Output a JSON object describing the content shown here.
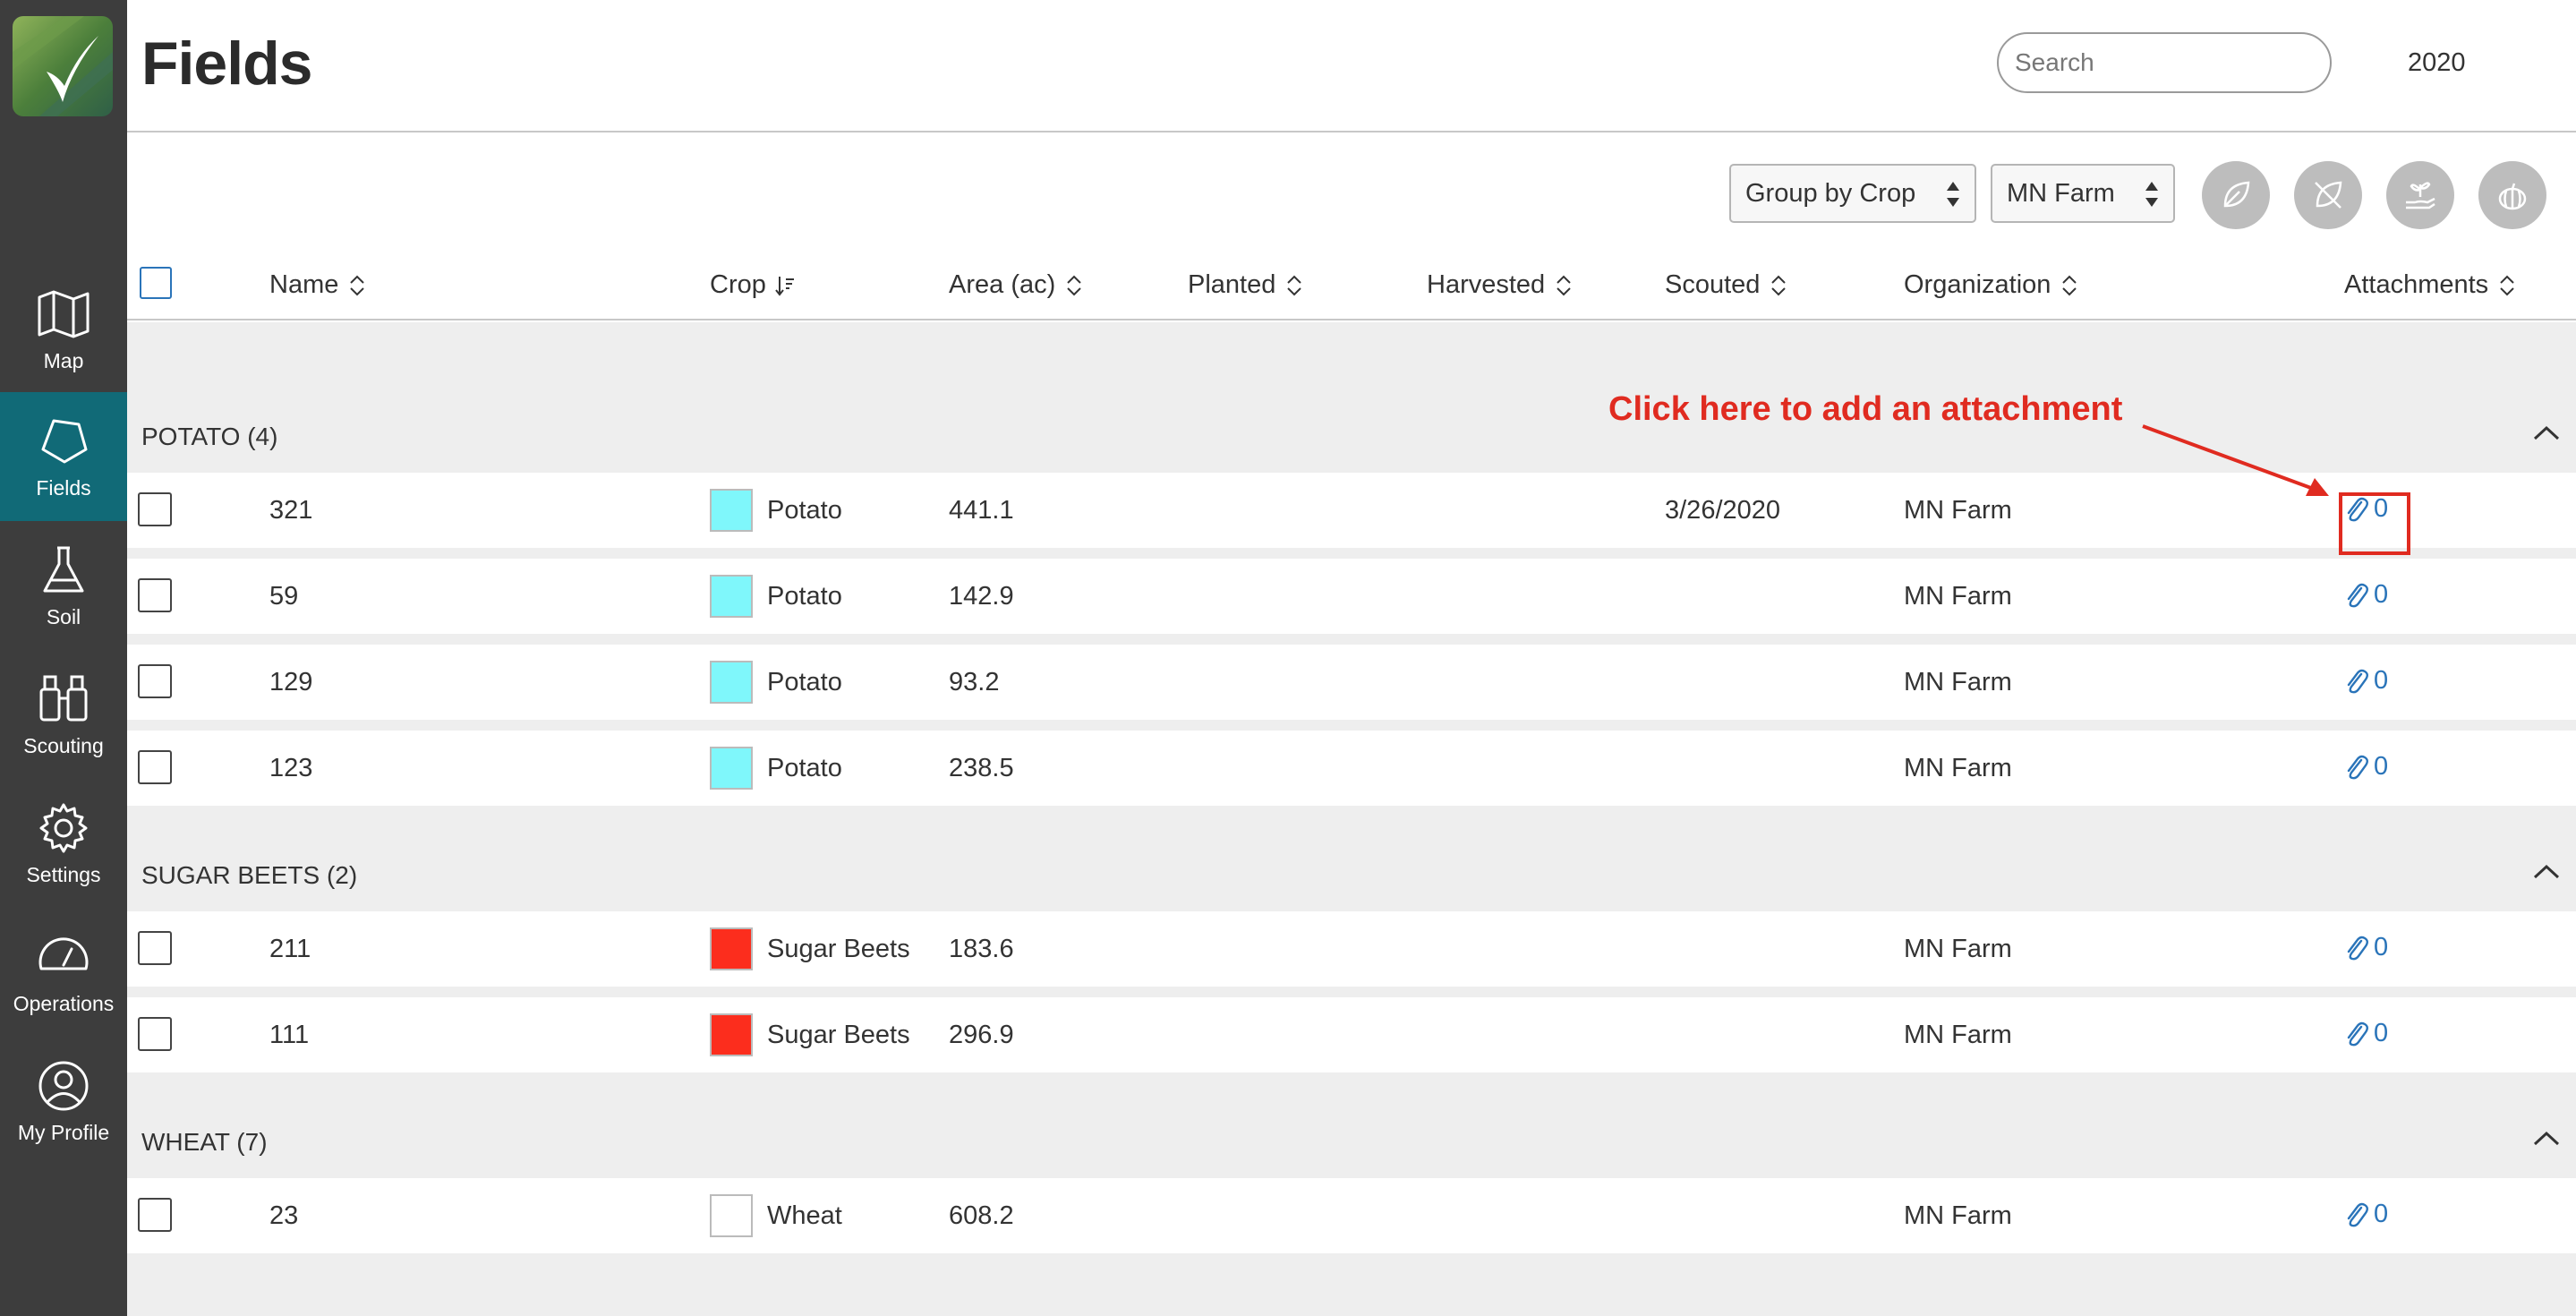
{
  "app": {
    "page_title": "Fields",
    "search_placeholder": "Search",
    "year": "2020"
  },
  "sidebar": {
    "items": [
      {
        "label": "Map",
        "icon": "map-icon"
      },
      {
        "label": "Fields",
        "icon": "field-icon",
        "active": true
      },
      {
        "label": "Soil",
        "icon": "flask-icon"
      },
      {
        "label": "Scouting",
        "icon": "binoculars-icon"
      },
      {
        "label": "Settings",
        "icon": "gear-icon"
      },
      {
        "label": "Operations",
        "icon": "gauge-icon"
      },
      {
        "label": "My Profile",
        "icon": "user-icon"
      }
    ]
  },
  "toolbar": {
    "group_by": "Group by Crop",
    "farm": "MN Farm",
    "action_icons": [
      "leaf-icon",
      "no-leaf-icon",
      "hand-plant-icon",
      "pumpkin-icon"
    ]
  },
  "table": {
    "columns": [
      "Name",
      "Crop",
      "Area (ac)",
      "Planted",
      "Harvested",
      "Scouted",
      "Organization",
      "Attachments"
    ],
    "groups": [
      {
        "title": "POTATO (4)",
        "rows": [
          {
            "name": "321",
            "crop": "Potato",
            "color": "#7ff7fb",
            "area": "441.1",
            "planted": "",
            "harvested": "",
            "scouted": "3/26/2020",
            "org": "MN Farm",
            "attachments": "0"
          },
          {
            "name": "59",
            "crop": "Potato",
            "color": "#7ff7fb",
            "area": "142.9",
            "planted": "",
            "harvested": "",
            "scouted": "",
            "org": "MN Farm",
            "attachments": "0"
          },
          {
            "name": "129",
            "crop": "Potato",
            "color": "#7ff7fb",
            "area": "93.2",
            "planted": "",
            "harvested": "",
            "scouted": "",
            "org": "MN Farm",
            "attachments": "0"
          },
          {
            "name": "123",
            "crop": "Potato",
            "color": "#7ff7fb",
            "area": "238.5",
            "planted": "",
            "harvested": "",
            "scouted": "",
            "org": "MN Farm",
            "attachments": "0"
          }
        ]
      },
      {
        "title": "SUGAR BEETS (2)",
        "rows": [
          {
            "name": "211",
            "crop": "Sugar Beets",
            "color": "#fc2d1d",
            "area": "183.6",
            "planted": "",
            "harvested": "",
            "scouted": "",
            "org": "MN Farm",
            "attachments": "0"
          },
          {
            "name": "111",
            "crop": "Sugar Beets",
            "color": "#fc2d1d",
            "area": "296.9",
            "planted": "",
            "harvested": "",
            "scouted": "",
            "org": "MN Farm",
            "attachments": "0"
          }
        ]
      },
      {
        "title": "WHEAT (7)",
        "rows": [
          {
            "name": "23",
            "crop": "Wheat",
            "color": "#ffffff",
            "area": "608.2",
            "planted": "",
            "harvested": "",
            "scouted": "",
            "org": "MN Farm",
            "attachments": "0"
          }
        ]
      }
    ]
  },
  "annotation": {
    "text": "Click here to add an attachment"
  },
  "colors": {
    "sidebar_bg": "#3d3d3d",
    "active_nav": "#116a77",
    "link_blue": "#2a74b9",
    "annotation_red": "#e02b20"
  }
}
